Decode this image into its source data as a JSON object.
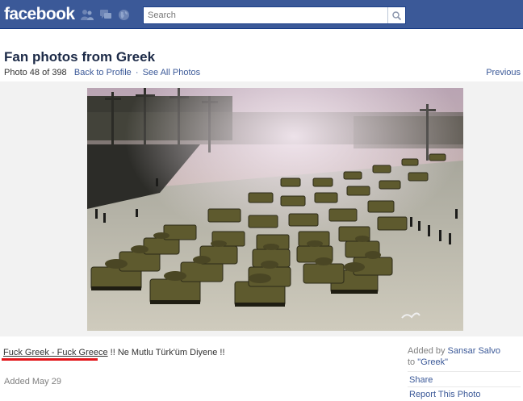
{
  "topbar": {
    "logo": "facebook",
    "bg_color": "#3b5998",
    "jewels": [
      "friend-requests-icon",
      "messages-icon",
      "notifications-globe-icon"
    ],
    "search_placeholder": "Search",
    "search_icon": "magnifier-icon"
  },
  "header": {
    "title": "Fan photos from Greek",
    "photo_count": "Photo 48 of 398",
    "back_link": "Back to Profile",
    "separator": "·",
    "see_all": "See All Photos",
    "previous": "Previous"
  },
  "photo": {
    "subject": "military-parade-tanks-photo"
  },
  "caption": {
    "underlined_part": "Fuck Greek - Fuck Greece",
    "rest": " !! Ne Mutlu Türk'üm Diyene !!",
    "highlight_color": "#e2161b"
  },
  "details": {
    "added_date": "Added May 29",
    "added_by_prefix": "Added by ",
    "added_by_name": "Sansar Salvo",
    "to_prefix": "to ",
    "to_album": "\"Greek\"",
    "share": "Share",
    "report": "Report This Photo"
  }
}
